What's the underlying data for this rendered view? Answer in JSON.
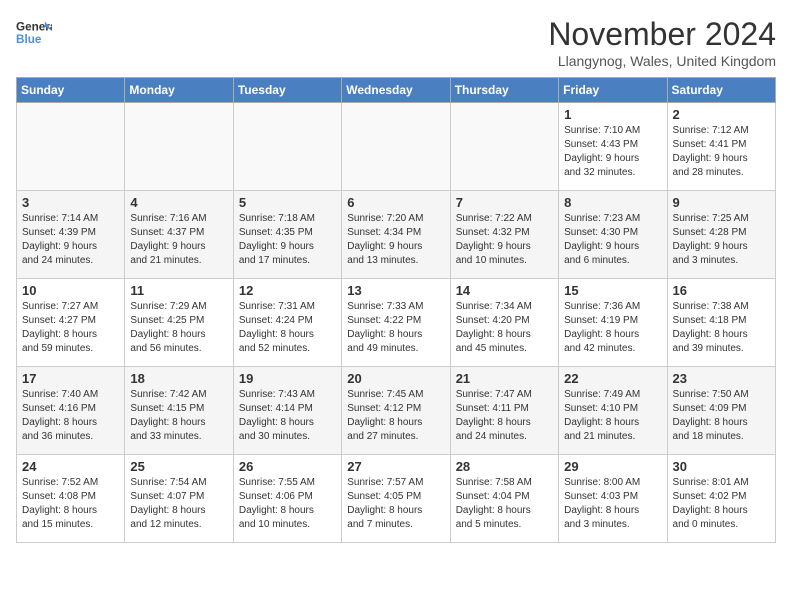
{
  "logo": {
    "line1": "General",
    "line2": "Blue"
  },
  "title": "November 2024",
  "location": "Llangynog, Wales, United Kingdom",
  "days_of_week": [
    "Sunday",
    "Monday",
    "Tuesday",
    "Wednesday",
    "Thursday",
    "Friday",
    "Saturday"
  ],
  "weeks": [
    [
      {
        "day": "",
        "info": ""
      },
      {
        "day": "",
        "info": ""
      },
      {
        "day": "",
        "info": ""
      },
      {
        "day": "",
        "info": ""
      },
      {
        "day": "",
        "info": ""
      },
      {
        "day": "1",
        "info": "Sunrise: 7:10 AM\nSunset: 4:43 PM\nDaylight: 9 hours\nand 32 minutes."
      },
      {
        "day": "2",
        "info": "Sunrise: 7:12 AM\nSunset: 4:41 PM\nDaylight: 9 hours\nand 28 minutes."
      }
    ],
    [
      {
        "day": "3",
        "info": "Sunrise: 7:14 AM\nSunset: 4:39 PM\nDaylight: 9 hours\nand 24 minutes."
      },
      {
        "day": "4",
        "info": "Sunrise: 7:16 AM\nSunset: 4:37 PM\nDaylight: 9 hours\nand 21 minutes."
      },
      {
        "day": "5",
        "info": "Sunrise: 7:18 AM\nSunset: 4:35 PM\nDaylight: 9 hours\nand 17 minutes."
      },
      {
        "day": "6",
        "info": "Sunrise: 7:20 AM\nSunset: 4:34 PM\nDaylight: 9 hours\nand 13 minutes."
      },
      {
        "day": "7",
        "info": "Sunrise: 7:22 AM\nSunset: 4:32 PM\nDaylight: 9 hours\nand 10 minutes."
      },
      {
        "day": "8",
        "info": "Sunrise: 7:23 AM\nSunset: 4:30 PM\nDaylight: 9 hours\nand 6 minutes."
      },
      {
        "day": "9",
        "info": "Sunrise: 7:25 AM\nSunset: 4:28 PM\nDaylight: 9 hours\nand 3 minutes."
      }
    ],
    [
      {
        "day": "10",
        "info": "Sunrise: 7:27 AM\nSunset: 4:27 PM\nDaylight: 8 hours\nand 59 minutes."
      },
      {
        "day": "11",
        "info": "Sunrise: 7:29 AM\nSunset: 4:25 PM\nDaylight: 8 hours\nand 56 minutes."
      },
      {
        "day": "12",
        "info": "Sunrise: 7:31 AM\nSunset: 4:24 PM\nDaylight: 8 hours\nand 52 minutes."
      },
      {
        "day": "13",
        "info": "Sunrise: 7:33 AM\nSunset: 4:22 PM\nDaylight: 8 hours\nand 49 minutes."
      },
      {
        "day": "14",
        "info": "Sunrise: 7:34 AM\nSunset: 4:20 PM\nDaylight: 8 hours\nand 45 minutes."
      },
      {
        "day": "15",
        "info": "Sunrise: 7:36 AM\nSunset: 4:19 PM\nDaylight: 8 hours\nand 42 minutes."
      },
      {
        "day": "16",
        "info": "Sunrise: 7:38 AM\nSunset: 4:18 PM\nDaylight: 8 hours\nand 39 minutes."
      }
    ],
    [
      {
        "day": "17",
        "info": "Sunrise: 7:40 AM\nSunset: 4:16 PM\nDaylight: 8 hours\nand 36 minutes."
      },
      {
        "day": "18",
        "info": "Sunrise: 7:42 AM\nSunset: 4:15 PM\nDaylight: 8 hours\nand 33 minutes."
      },
      {
        "day": "19",
        "info": "Sunrise: 7:43 AM\nSunset: 4:14 PM\nDaylight: 8 hours\nand 30 minutes."
      },
      {
        "day": "20",
        "info": "Sunrise: 7:45 AM\nSunset: 4:12 PM\nDaylight: 8 hours\nand 27 minutes."
      },
      {
        "day": "21",
        "info": "Sunrise: 7:47 AM\nSunset: 4:11 PM\nDaylight: 8 hours\nand 24 minutes."
      },
      {
        "day": "22",
        "info": "Sunrise: 7:49 AM\nSunset: 4:10 PM\nDaylight: 8 hours\nand 21 minutes."
      },
      {
        "day": "23",
        "info": "Sunrise: 7:50 AM\nSunset: 4:09 PM\nDaylight: 8 hours\nand 18 minutes."
      }
    ],
    [
      {
        "day": "24",
        "info": "Sunrise: 7:52 AM\nSunset: 4:08 PM\nDaylight: 8 hours\nand 15 minutes."
      },
      {
        "day": "25",
        "info": "Sunrise: 7:54 AM\nSunset: 4:07 PM\nDaylight: 8 hours\nand 12 minutes."
      },
      {
        "day": "26",
        "info": "Sunrise: 7:55 AM\nSunset: 4:06 PM\nDaylight: 8 hours\nand 10 minutes."
      },
      {
        "day": "27",
        "info": "Sunrise: 7:57 AM\nSunset: 4:05 PM\nDaylight: 8 hours\nand 7 minutes."
      },
      {
        "day": "28",
        "info": "Sunrise: 7:58 AM\nSunset: 4:04 PM\nDaylight: 8 hours\nand 5 minutes."
      },
      {
        "day": "29",
        "info": "Sunrise: 8:00 AM\nSunset: 4:03 PM\nDaylight: 8 hours\nand 3 minutes."
      },
      {
        "day": "30",
        "info": "Sunrise: 8:01 AM\nSunset: 4:02 PM\nDaylight: 8 hours\nand 0 minutes."
      }
    ]
  ]
}
